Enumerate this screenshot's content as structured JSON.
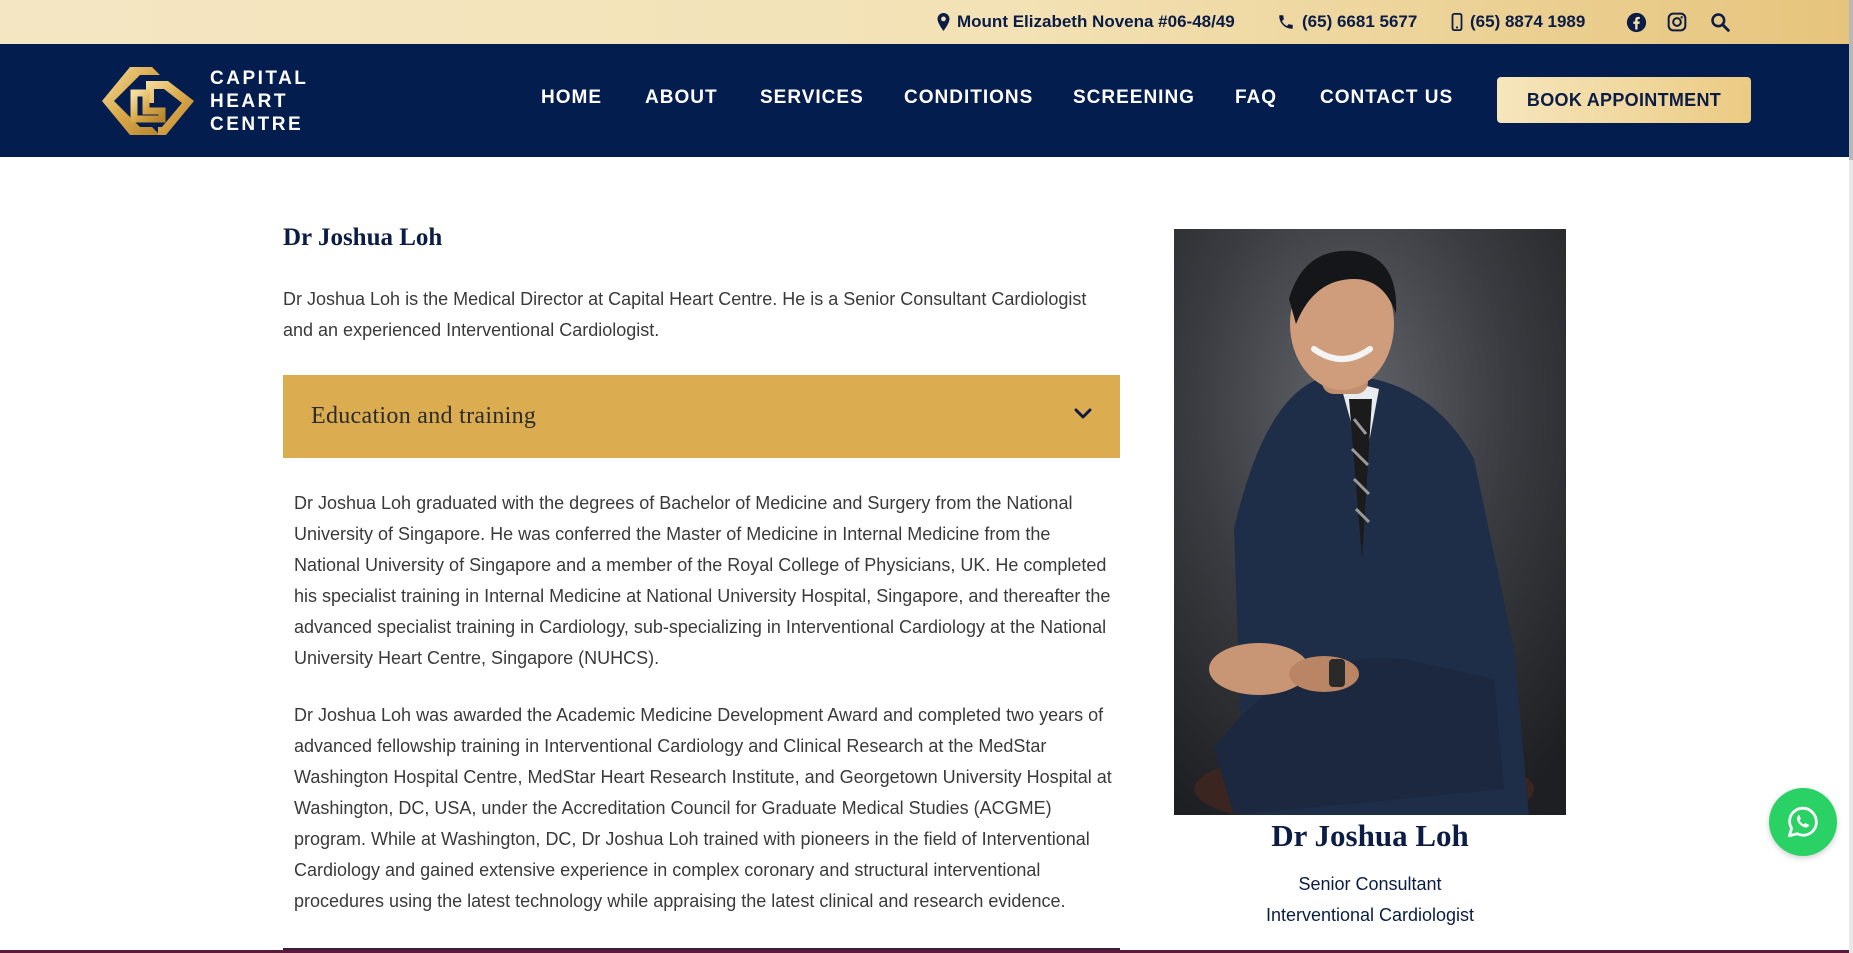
{
  "topbar": {
    "address": "Mount Elizabeth Novena #06-48/49",
    "phone": "(65) 6681 5677",
    "mobile": "(65) 8874 1989",
    "icons": [
      "map-pin-icon",
      "phone-icon",
      "mobile-icon",
      "facebook-icon",
      "instagram-icon",
      "search-icon"
    ]
  },
  "brand": {
    "line1": "CAPITAL",
    "line2": "HEART",
    "line3": "CENTRE",
    "gold": "#dcad50",
    "navy": "#041d4f"
  },
  "nav": {
    "items": [
      "HOME",
      "ABOUT",
      "SERVICES",
      "CONDITIONS",
      "SCREENING",
      "FAQ",
      "CONTACT US"
    ],
    "cta": "BOOK APPOINTMENT"
  },
  "profile": {
    "name": "Dr Joshua Loh",
    "intro": "Dr Joshua Loh is the Medical Director at Capital Heart Centre. He is a Senior Consultant Cardiologist and an experienced Interventional Cardiologist.",
    "accordion_title": "Education and training",
    "paragraphs": [
      "Dr Joshua Loh graduated with the degrees of Bachelor of Medicine and Surgery from the National University of Singapore. He was conferred the Master of Medicine in Internal Medicine from the National University of Singapore and a member of the Royal College of Physicians, UK. He completed his specialist training in Internal Medicine at National University Hospital, Singapore, and thereafter the advanced specialist training in Cardiology, sub-specializing in Interventional Cardiology at the National University Heart Centre, Singapore (NUHCS).",
      "Dr Joshua Loh was awarded the Academic Medicine Development Award and completed two years of advanced fellowship training in Interventional Cardiology and Clinical Research at the MedStar Washington Hospital Centre, MedStar Heart Research Institute, and Georgetown University Hospital at Washington, DC, USA, under the Accreditation Council for Graduate Medical Studies (ACGME) program. While at Washington, DC, Dr Joshua Loh trained with pioneers in the field of Interventional Cardiology and gained extensive experience in complex coronary and structural interventional procedures using the latest technology while appraising the latest clinical and research evidence."
    ]
  },
  "card": {
    "name": "Dr Joshua Loh",
    "role1": "Senior Consultant",
    "role2": "Interventional Cardiologist"
  },
  "floating": {
    "icon": "whatsapp-icon",
    "color": "#2ad266"
  }
}
